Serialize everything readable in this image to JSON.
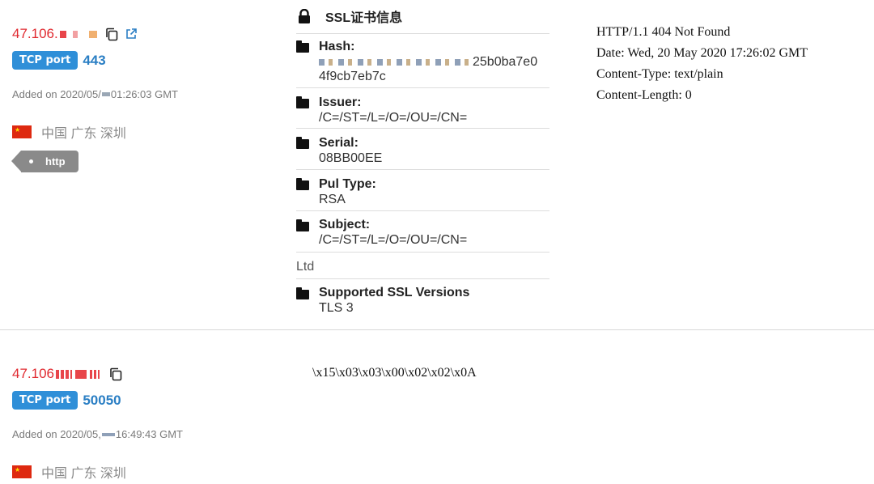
{
  "results": [
    {
      "ip": "47.106.",
      "port_badge": "TCP port",
      "port": "443",
      "added": "Added on 2020/05/",
      "added_time": " 01:26:03 GMT",
      "location": "中国 广东 深圳",
      "tag": "http",
      "ssl": {
        "title": "SSL证书信息",
        "hash_label": "Hash:",
        "hash_value_1": "25b0ba7e0",
        "hash_value_2": "4f9cb7eb7c",
        "issuer_label": "Issuer:",
        "issuer_value": "/C=/ST=/L=/O=/OU=/CN=",
        "serial_label": "Serial:",
        "serial_value": "08BB00EE",
        "pubtype_label": "Pul Type:",
        "pubtype_value": "RSA",
        "subject_label": "Subject:",
        "subject_value": "/C=/ST=/L=/O=/OU=/CN=",
        "org": "Ltd",
        "versions_label": "Supported SSL Versions",
        "versions_value": "TLS 3"
      },
      "response": [
        "HTTP/1.1 404 Not Found",
        "Date: Wed, 20 May 2020 17:26:02 GMT",
        "Content-Type: text/plain",
        "Content-Length: 0"
      ]
    },
    {
      "ip": "47.106",
      "port_badge": "TCP port",
      "port": "50050",
      "added": "Added on 2020/05,",
      "added_time": " 16:49:43 GMT",
      "location": "中国 广东 深圳",
      "response": [
        "\\x15\\x03\\x03\\x00\\x02\\x02\\x0A"
      ]
    }
  ],
  "colors": {
    "ip": "#e0292f",
    "badge": "#2f8fd8",
    "port": "#2b7fc4",
    "tag": "#8a8a8a"
  }
}
